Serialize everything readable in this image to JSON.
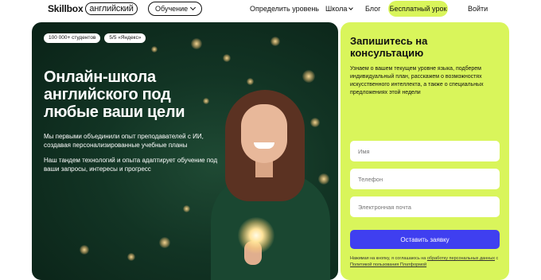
{
  "header": {
    "logo_brand": "Skillbox",
    "logo_tag": "английский",
    "menu_label": "Обучение",
    "nav": {
      "level": "Определить уровень",
      "school": "Школа",
      "blog": "Блог",
      "free_lesson": "Бесплатный урок",
      "login": "Войти"
    }
  },
  "hero": {
    "badges": [
      "100 000+ студентов",
      "5/5 «Яндекс»"
    ],
    "title": "Онлайн-школа английского под любые ваши цели",
    "text1": "Мы первыми объединили опыт преподавателей с ИИ, создавая персонализированные учебные планы",
    "text2": "Наш тандем технологий и опыта адаптирует обучение под ваши запросы, интересы и прогресс"
  },
  "form": {
    "title": "Запишитесь на консультацию",
    "description": "Узнаем о вашем текущем уровне языка, подберем индивидуальный план, расскажем о возможностях искусственного интеллекта, а также о специальных предложениях этой недели",
    "name_placeholder": "Имя",
    "phone_placeholder": "Телефон",
    "email_placeholder": "Электронная почта",
    "submit_label": "Оставить заявку",
    "legal_prefix": "Нажимая на кнопку, я соглашаюсь на ",
    "legal_link1": "обработку персональных данных",
    "legal_mid": " с ",
    "legal_link2": "Политикой пользования Платформой"
  },
  "colors": {
    "accent_lime": "#d9f55b",
    "button_blue": "#3f3ff0",
    "hero_green": "#123424"
  }
}
